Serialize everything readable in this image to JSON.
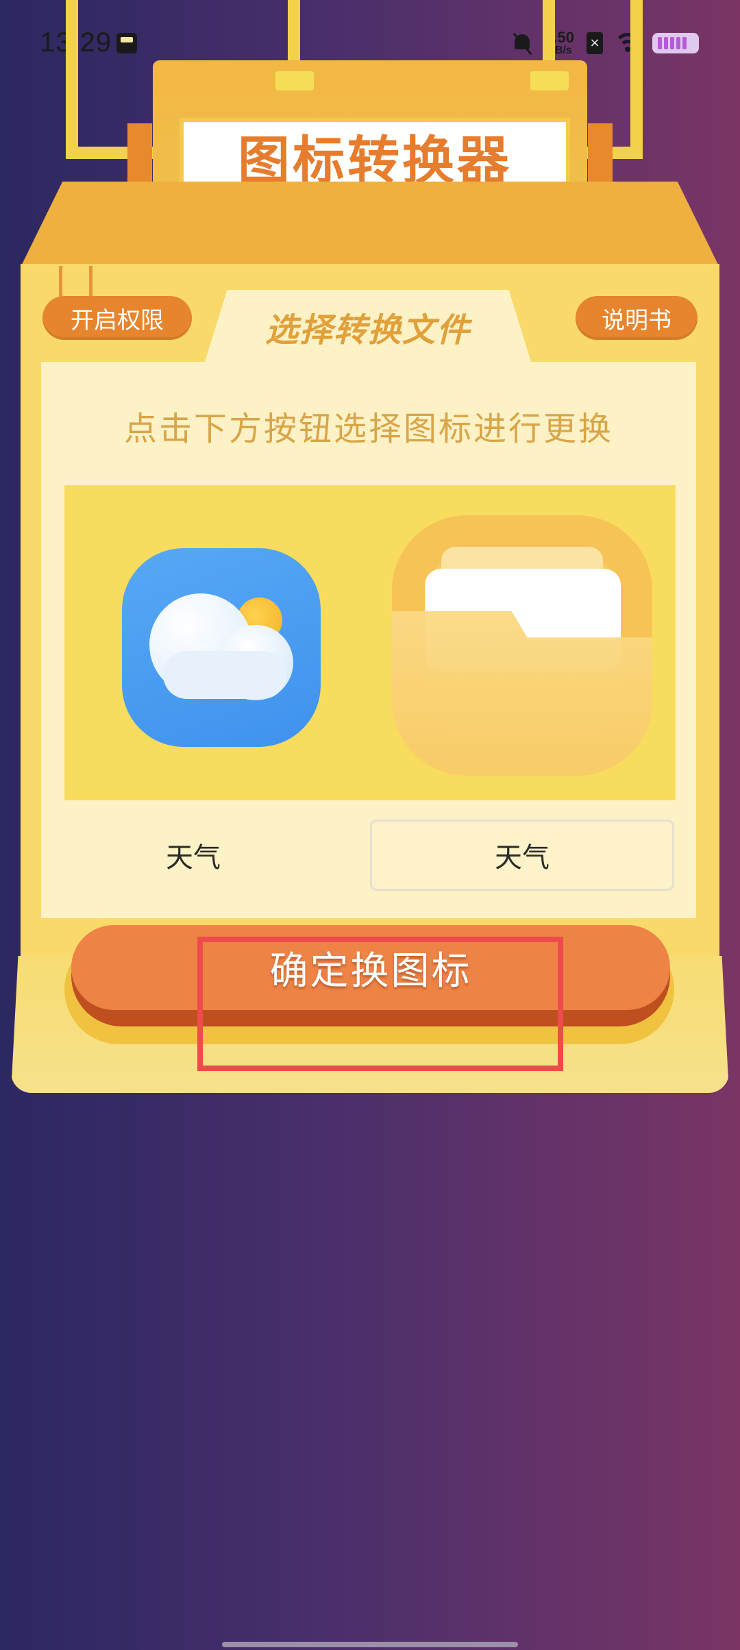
{
  "status_bar": {
    "time": "13:29",
    "net_speed_value": "0.50",
    "net_speed_unit": "KB/s",
    "sim_label": "×",
    "icons": [
      "app-notification-icon",
      "mute-icon",
      "sim-icon",
      "wifi-icon",
      "battery-icon"
    ]
  },
  "header": {
    "title": "图标转换器"
  },
  "toolbar": {
    "permission_label": "开启权限",
    "manual_label": "说明书",
    "tab_title": "选择转换文件"
  },
  "panel": {
    "instruction": "点击下方按钮选择图标进行更换",
    "original_icon": "weather-app-icon",
    "new_icon": "folder-app-icon",
    "original_name": "天气",
    "new_name_value": "天气"
  },
  "actions": {
    "confirm_label": "确定换图标"
  },
  "colors": {
    "accent_orange": "#e7852e",
    "highlight_red": "#ee4c4c",
    "machine_yellow": "#f8d96a"
  }
}
